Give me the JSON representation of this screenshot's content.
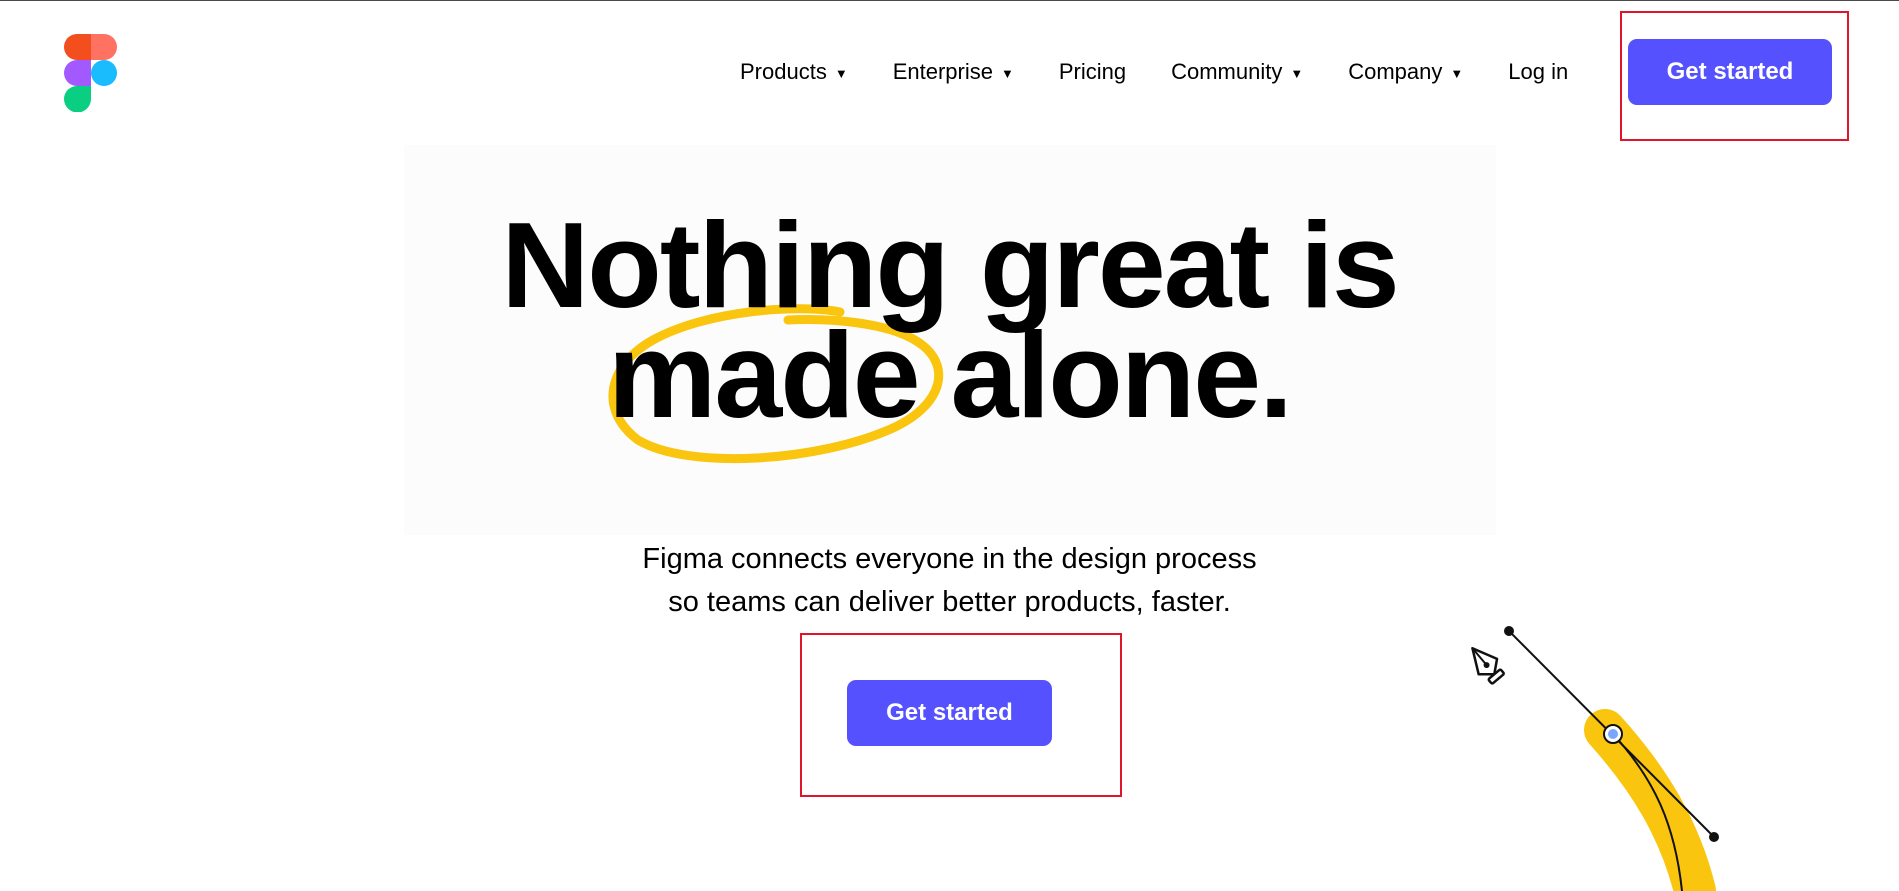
{
  "nav": {
    "items": [
      {
        "label": "Products",
        "dropdown": true
      },
      {
        "label": "Enterprise",
        "dropdown": true
      },
      {
        "label": "Pricing",
        "dropdown": false
      },
      {
        "label": "Community",
        "dropdown": true
      },
      {
        "label": "Company",
        "dropdown": true
      },
      {
        "label": "Log in",
        "dropdown": false
      }
    ],
    "caret": "▼",
    "cta_label": "Get started"
  },
  "hero": {
    "headline_line1": "Nothing great is",
    "headline_word_circled": "made",
    "headline_line2_rest": " alone.",
    "subtext_line1": "Figma connects everyone in the design process",
    "subtext_line2": "so teams can deliver better products, faster.",
    "cta_label": "Get started"
  },
  "icons": {
    "logo": "figma-logo-icon",
    "pen": "pen-tool-icon"
  },
  "colors": {
    "primary_button": "#5551ff",
    "highlight_box": "#e0142a",
    "accent_yellow": "#f9c50e",
    "logo_red": "#f24e1e",
    "logo_salmon": "#ff7262",
    "logo_purple": "#a259ff",
    "logo_blue": "#1abcfe",
    "logo_green": "#0acf83"
  }
}
